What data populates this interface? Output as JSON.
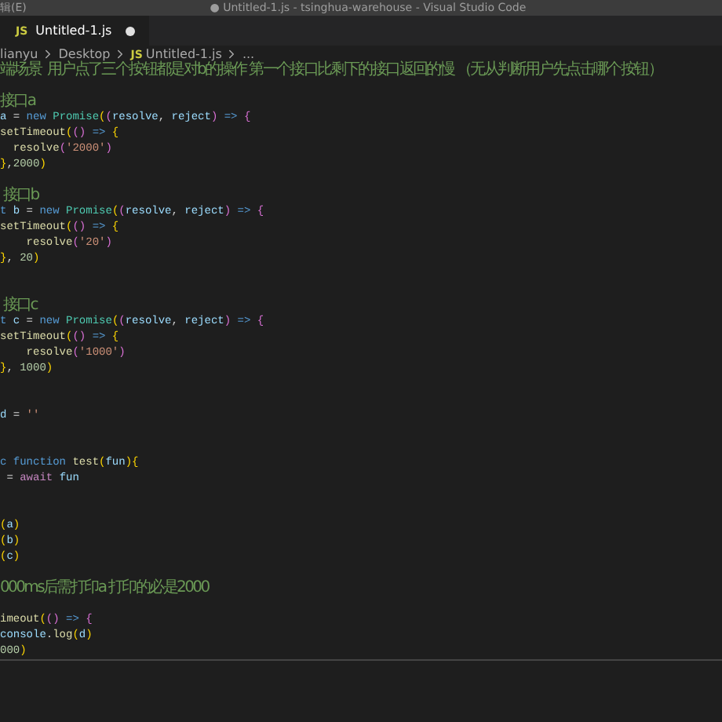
{
  "title_bar": {
    "menu": "辑(E)",
    "title": "● Untitled-1.js - tsinghua-warehouse - Visual Studio Code"
  },
  "tabs": [
    {
      "badge": "JS",
      "label": "Untitled-1.js",
      "selected": true,
      "modified": true
    }
  ],
  "breadcrumb": [
    {
      "label": "lianyu"
    },
    {
      "label": "Desktop"
    },
    {
      "badge": "JS",
      "label": "Untitled-1.js"
    },
    {
      "label": "..."
    }
  ],
  "code_lines": [
    {
      "kind": "code",
      "tokens": [
        {
          "kind": "comment",
          "text": "端场景  用户点了三个按钮都是对b的操作 第一个接口比剩下的接口返回的慢 （无从判断用户先点击哪个按钮）"
        }
      ]
    },
    {
      "kind": "blank"
    },
    {
      "kind": "code",
      "tokens": [
        {
          "kind": "comment",
          "text": "接口a"
        }
      ]
    },
    {
      "kind": "code",
      "tokens": [
        {
          "kind": "var",
          "text": "a"
        },
        {
          "kind": "plain",
          "text": " ="
        },
        {
          "kind": "keyword",
          "text": " new"
        },
        {
          "kind": "class",
          "text": " Promise"
        },
        {
          "kind": "bracket1",
          "text": "("
        },
        {
          "kind": "bracket2",
          "text": "("
        },
        {
          "kind": "var",
          "text": "resolve"
        },
        {
          "kind": "plain",
          "text": ","
        },
        {
          "kind": "var",
          "text": " reject"
        },
        {
          "kind": "bracket2",
          "text": ")"
        },
        {
          "kind": "keyword",
          "text": " =>"
        },
        {
          "kind": "bracket2",
          "text": " {"
        }
      ]
    },
    {
      "kind": "code",
      "tokens": [
        {
          "kind": "fn",
          "text": "setTimeout"
        },
        {
          "kind": "bracket1",
          "text": "("
        },
        {
          "kind": "bracket2",
          "text": "()"
        },
        {
          "kind": "keyword",
          "text": " =>"
        },
        {
          "kind": "bracket1",
          "text": " {"
        }
      ]
    },
    {
      "kind": "code",
      "tokens": [
        {
          "kind": "fn",
          "text": "  resolve"
        },
        {
          "kind": "bracket2",
          "text": "("
        },
        {
          "kind": "string",
          "text": "'2000'"
        },
        {
          "kind": "bracket2",
          "text": ")"
        }
      ]
    },
    {
      "kind": "code",
      "tokens": [
        {
          "kind": "bracket1",
          "text": "}"
        },
        {
          "kind": "plain",
          "text": ","
        },
        {
          "kind": "number",
          "text": "2000"
        },
        {
          "kind": "bracket1",
          "text": ")"
        }
      ]
    },
    {
      "kind": "blank"
    },
    {
      "kind": "code",
      "tokens": [
        {
          "kind": "comment",
          "text": " 接口b"
        }
      ]
    },
    {
      "kind": "code",
      "tokens": [
        {
          "kind": "keyword",
          "text": "t"
        },
        {
          "kind": "var",
          "text": " b"
        },
        {
          "kind": "plain",
          "text": " ="
        },
        {
          "kind": "keyword",
          "text": " new"
        },
        {
          "kind": "class",
          "text": " Promise"
        },
        {
          "kind": "bracket1",
          "text": "("
        },
        {
          "kind": "bracket2",
          "text": "("
        },
        {
          "kind": "var",
          "text": "resolve"
        },
        {
          "kind": "plain",
          "text": ","
        },
        {
          "kind": "var",
          "text": " reject"
        },
        {
          "kind": "bracket2",
          "text": ")"
        },
        {
          "kind": "keyword",
          "text": " =>"
        },
        {
          "kind": "bracket2",
          "text": " {"
        }
      ]
    },
    {
      "kind": "code",
      "tokens": [
        {
          "kind": "fn",
          "text": "setTimeout"
        },
        {
          "kind": "bracket1",
          "text": "("
        },
        {
          "kind": "bracket2",
          "text": "()"
        },
        {
          "kind": "keyword",
          "text": " =>"
        },
        {
          "kind": "bracket1",
          "text": " {"
        }
      ]
    },
    {
      "kind": "code",
      "tokens": [
        {
          "kind": "fn",
          "text": "    resolve"
        },
        {
          "kind": "bracket2",
          "text": "("
        },
        {
          "kind": "string",
          "text": "'20'"
        },
        {
          "kind": "bracket2",
          "text": ")"
        }
      ]
    },
    {
      "kind": "code",
      "tokens": [
        {
          "kind": "bracket1",
          "text": "}"
        },
        {
          "kind": "plain",
          "text": ","
        },
        {
          "kind": "number",
          "text": " 20"
        },
        {
          "kind": "bracket1",
          "text": ")"
        }
      ]
    },
    {
      "kind": "blank"
    },
    {
      "kind": "blank"
    },
    {
      "kind": "code",
      "tokens": [
        {
          "kind": "comment",
          "text": " 接口c"
        }
      ]
    },
    {
      "kind": "code",
      "tokens": [
        {
          "kind": "keyword",
          "text": "t"
        },
        {
          "kind": "var",
          "text": " c"
        },
        {
          "kind": "plain",
          "text": " ="
        },
        {
          "kind": "keyword",
          "text": " new"
        },
        {
          "kind": "class",
          "text": " Promise"
        },
        {
          "kind": "bracket1",
          "text": "("
        },
        {
          "kind": "bracket2",
          "text": "("
        },
        {
          "kind": "var",
          "text": "resolve"
        },
        {
          "kind": "plain",
          "text": ","
        },
        {
          "kind": "var",
          "text": " reject"
        },
        {
          "kind": "bracket2",
          "text": ")"
        },
        {
          "kind": "keyword",
          "text": " =>"
        },
        {
          "kind": "bracket2",
          "text": " {"
        }
      ]
    },
    {
      "kind": "code",
      "tokens": [
        {
          "kind": "fn",
          "text": "setTimeout"
        },
        {
          "kind": "bracket1",
          "text": "("
        },
        {
          "kind": "bracket2",
          "text": "()"
        },
        {
          "kind": "keyword",
          "text": " =>"
        },
        {
          "kind": "bracket1",
          "text": " {"
        }
      ]
    },
    {
      "kind": "code",
      "tokens": [
        {
          "kind": "fn",
          "text": "    resolve"
        },
        {
          "kind": "bracket2",
          "text": "("
        },
        {
          "kind": "string",
          "text": "'1000'"
        },
        {
          "kind": "bracket2",
          "text": ")"
        }
      ]
    },
    {
      "kind": "code",
      "tokens": [
        {
          "kind": "bracket1",
          "text": "}"
        },
        {
          "kind": "plain",
          "text": ","
        },
        {
          "kind": "number",
          "text": " 1000"
        },
        {
          "kind": "bracket1",
          "text": ")"
        }
      ]
    },
    {
      "kind": "blank"
    },
    {
      "kind": "blank"
    },
    {
      "kind": "code",
      "tokens": [
        {
          "kind": "var",
          "text": "d"
        },
        {
          "kind": "plain",
          "text": " ="
        },
        {
          "kind": "string",
          "text": " ''"
        }
      ]
    },
    {
      "kind": "blank"
    },
    {
      "kind": "blank"
    },
    {
      "kind": "code",
      "tokens": [
        {
          "kind": "keyword",
          "text": "c"
        },
        {
          "kind": "keyword",
          "text": " function"
        },
        {
          "kind": "fn",
          "text": " test"
        },
        {
          "kind": "bracket1",
          "text": "("
        },
        {
          "kind": "var",
          "text": "fun"
        },
        {
          "kind": "bracket1",
          "text": ")"
        },
        {
          "kind": "bracket1",
          "text": "{"
        }
      ]
    },
    {
      "kind": "code",
      "tokens": [
        {
          "kind": "plain",
          "text": " ="
        },
        {
          "kind": "control",
          "text": " await"
        },
        {
          "kind": "var",
          "text": " fun"
        }
      ]
    },
    {
      "kind": "blank"
    },
    {
      "kind": "blank"
    },
    {
      "kind": "code",
      "tokens": [
        {
          "kind": "bracket1",
          "text": "("
        },
        {
          "kind": "var",
          "text": "a"
        },
        {
          "kind": "bracket1",
          "text": ")"
        }
      ]
    },
    {
      "kind": "code",
      "tokens": [
        {
          "kind": "bracket1",
          "text": "("
        },
        {
          "kind": "var",
          "text": "b"
        },
        {
          "kind": "bracket1",
          "text": ")"
        }
      ]
    },
    {
      "kind": "code",
      "tokens": [
        {
          "kind": "bracket1",
          "text": "("
        },
        {
          "kind": "var",
          "text": "c"
        },
        {
          "kind": "bracket1",
          "text": ")"
        }
      ]
    },
    {
      "kind": "blank"
    },
    {
      "kind": "code",
      "tokens": [
        {
          "kind": "comment",
          "text": "000ms后需打印a 打印的必是2000"
        }
      ]
    },
    {
      "kind": "blank"
    },
    {
      "kind": "code",
      "tokens": [
        {
          "kind": "fn",
          "text": "imeout"
        },
        {
          "kind": "bracket1",
          "text": "("
        },
        {
          "kind": "bracket2",
          "text": "()"
        },
        {
          "kind": "keyword",
          "text": " =>"
        },
        {
          "kind": "bracket2",
          "text": " {"
        }
      ]
    },
    {
      "kind": "code",
      "tokens": [
        {
          "kind": "var",
          "text": "console"
        },
        {
          "kind": "plain",
          "text": "."
        },
        {
          "kind": "fn",
          "text": "log"
        },
        {
          "kind": "bracket1",
          "text": "("
        },
        {
          "kind": "var",
          "text": "d"
        },
        {
          "kind": "bracket1",
          "text": ")"
        }
      ]
    },
    {
      "kind": "code",
      "tokens": [
        {
          "kind": "number",
          "text": "000"
        },
        {
          "kind": "bracket1",
          "text": ")"
        }
      ]
    }
  ]
}
